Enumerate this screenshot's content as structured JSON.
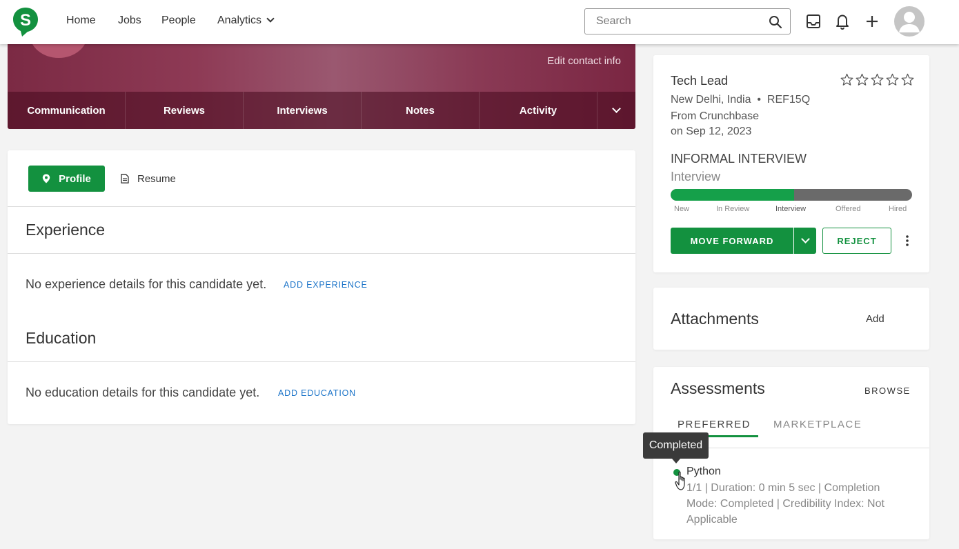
{
  "nav": {
    "links": [
      "Home",
      "Jobs",
      "People",
      "Analytics"
    ],
    "search_placeholder": "Search",
    "brand_color": "#13913f"
  },
  "banner": {
    "edit_contact": "Edit contact info",
    "tabs": [
      "Communication",
      "Reviews",
      "Interviews",
      "Notes",
      "Activity"
    ]
  },
  "profile": {
    "profile_btn": "Profile",
    "resume_btn": "Resume",
    "experience": {
      "title": "Experience",
      "empty": "No experience details for this candidate yet.",
      "add": "ADD EXPERIENCE"
    },
    "education": {
      "title": "Education",
      "empty": "No education details for this candidate yet.",
      "add": "ADD EDUCATION"
    }
  },
  "job": {
    "title": "Tech Lead",
    "location": "New Delhi, India",
    "ref": "REF15Q",
    "source": "From Crunchbase",
    "date": "on Sep 12, 2023",
    "stage": "INFORMAL INTERVIEW",
    "stage_sub": "Interview",
    "rating": 0,
    "progress": 0.51,
    "stages": [
      "New",
      "In Review",
      "Interview",
      "Offered",
      "Hired"
    ],
    "move_forward": "MOVE FORWARD",
    "reject": "REJECT"
  },
  "attachments": {
    "title": "Attachments",
    "add": "Add"
  },
  "assessments": {
    "title": "Assessments",
    "browse": "BROWSE",
    "tabs": [
      "PREFERRED",
      "MARKETPLACE"
    ],
    "tooltip": "Completed",
    "item": {
      "name": "Python",
      "detail": "1/1 | Duration: 0 min 5 sec | Completion Mode: Completed | Credibility Index: Not Applicable"
    }
  }
}
